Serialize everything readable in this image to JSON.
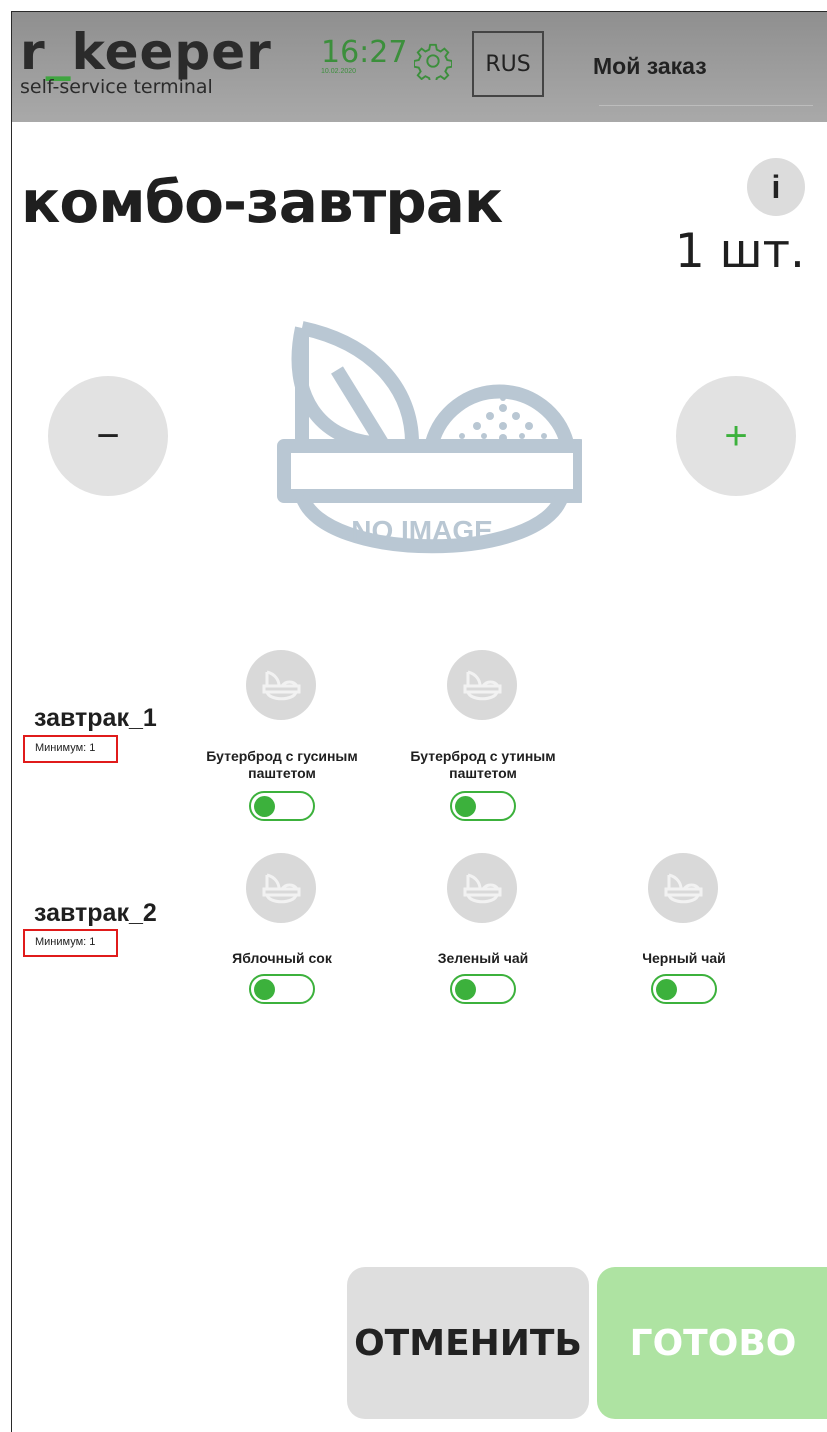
{
  "header": {
    "brand_name_pre": "r",
    "brand_name_us": "_",
    "brand_name_post": "keeper",
    "brand_sub": "self-service terminal",
    "time": "16:27",
    "date": "10.02.2020",
    "language": "RUS",
    "order_title": "Мой заказ"
  },
  "dish": {
    "title": "комбо-завтрак",
    "info_label": "i",
    "quantity": "1 шт.",
    "minus_label": "−",
    "plus_label": "+",
    "image_text": "NO IMAGE"
  },
  "groups": [
    {
      "label": "завтрак_1",
      "minimum": "Минимум: 1",
      "items": [
        {
          "name": "Бутерброд с гусиным паштетом",
          "on": true
        },
        {
          "name": "Бутерброд с утиным паштетом",
          "on": true
        }
      ]
    },
    {
      "label": "завтрак_2",
      "minimum": "Минимум: 1",
      "items": [
        {
          "name": "Яблочный сок",
          "on": true
        },
        {
          "name": "Зеленый чай",
          "on": true
        },
        {
          "name": "Черный чай",
          "on": true
        }
      ]
    }
  ],
  "footer": {
    "cancel_label": "ОТМЕНИТЬ",
    "ok_label": "ГОТОВО"
  },
  "colors": {
    "accent_green": "#3cb13c",
    "header_gray": "#a0a0a0",
    "ok_disabled": "#aee3a2",
    "minimum_outline": "#e01b1b"
  },
  "icons": {
    "settings": "gear-icon",
    "placeholder": "no-image-bowl-icon"
  }
}
